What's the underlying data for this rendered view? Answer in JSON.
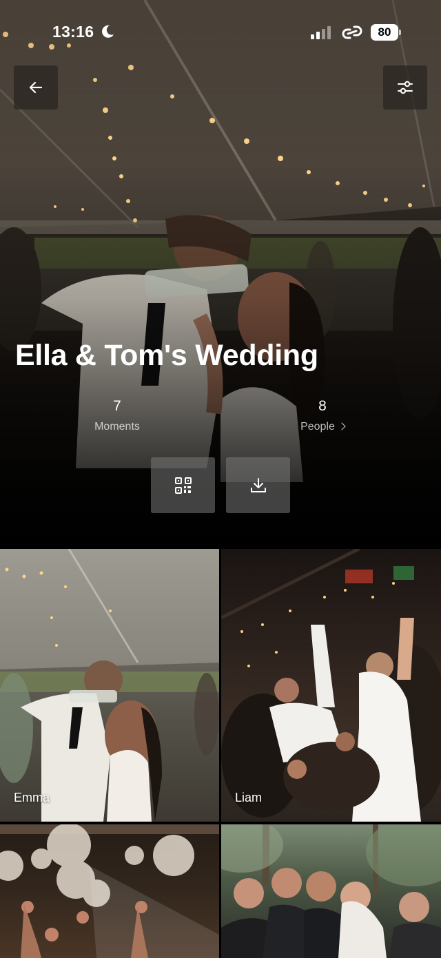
{
  "status_bar": {
    "time": "13:16",
    "battery": "80",
    "icons": [
      "moon-icon",
      "signal-icon",
      "link-icon",
      "battery-icon"
    ]
  },
  "header": {
    "back_icon": "arrow-left-icon",
    "filter_icon": "sliders-icon"
  },
  "event": {
    "title": "Ella & Tom's Wedding",
    "moments_count": "7",
    "moments_label": "Moments",
    "people_count": "8",
    "people_label": "People"
  },
  "actions": {
    "qr_icon": "qr-code-icon",
    "download_icon": "download-icon"
  },
  "moments": [
    {
      "label": "Emma"
    },
    {
      "label": "Liam"
    },
    {
      "label": ""
    },
    {
      "label": ""
    }
  ],
  "colors": {
    "background": "#000000",
    "button_overlay": "#3a3530",
    "action_button": "#787878"
  }
}
